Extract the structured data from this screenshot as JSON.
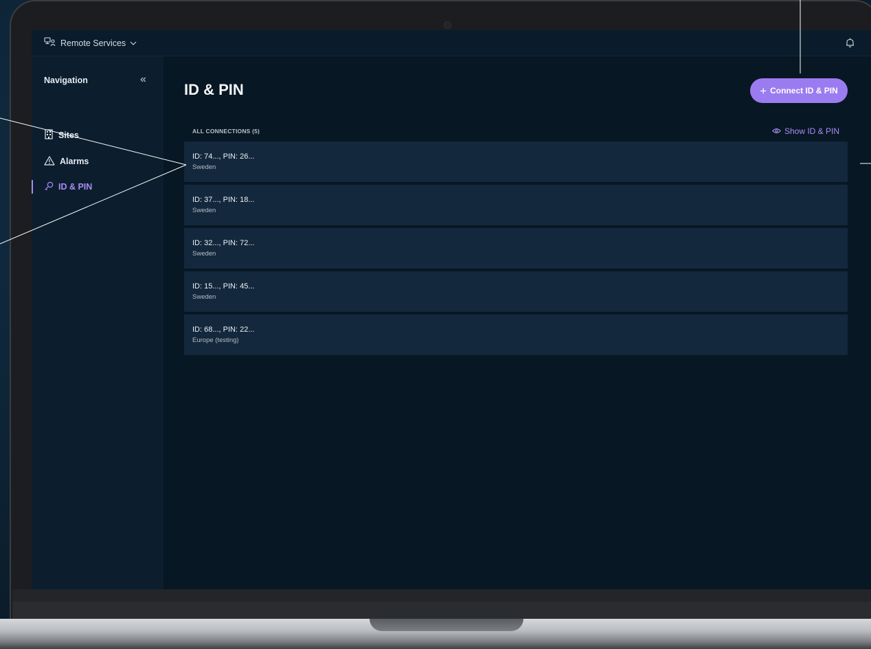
{
  "topbar": {
    "app_name": "Remote Services"
  },
  "sidebar": {
    "title": "Navigation",
    "items": [
      {
        "label": "Sites",
        "icon": "building-icon",
        "active": false
      },
      {
        "label": "Alarms",
        "icon": "warning-triangle-icon",
        "active": false
      },
      {
        "label": "ID & PIN",
        "icon": "key-icon",
        "active": true
      }
    ]
  },
  "main": {
    "title": "ID & PIN",
    "connect_button": "Connect ID & PIN",
    "section_label": "ALL CONNECTIONS (5)",
    "show_toggle": "Show ID & PIN",
    "connections": [
      {
        "id": "ID: 74..., PIN: 26...",
        "region": "Sweden"
      },
      {
        "id": "ID: 37..., PIN: 18...",
        "region": "Sweden"
      },
      {
        "id": "ID: 32..., PIN: 72...",
        "region": "Sweden"
      },
      {
        "id": "ID: 15..., PIN: 45...",
        "region": "Sweden"
      },
      {
        "id": "ID: 68..., PIN: 22...",
        "region": "Europe (testing)"
      }
    ]
  },
  "colors": {
    "accent": "#9b7cf0",
    "accent_text": "#a98cf5",
    "background": "#071723",
    "row": "#13283d"
  }
}
